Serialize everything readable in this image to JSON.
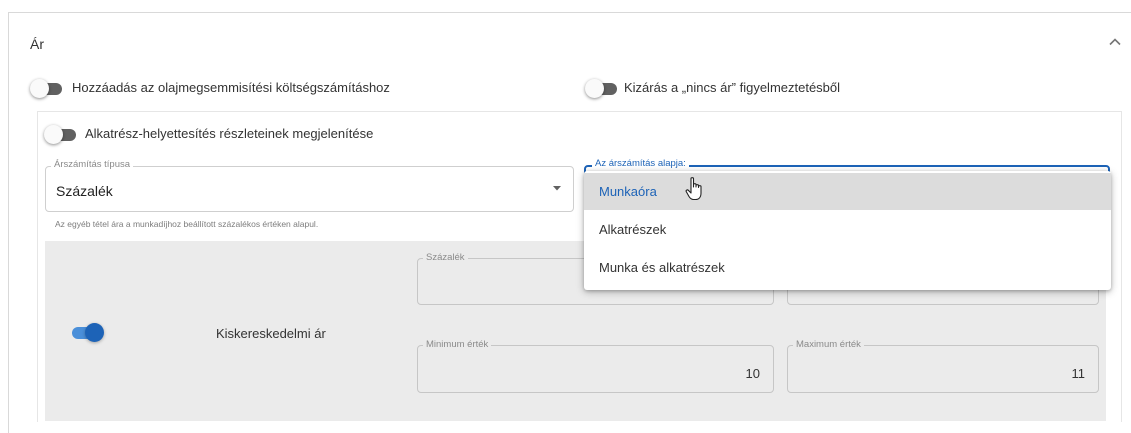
{
  "section": {
    "title": "Ár"
  },
  "toggles": {
    "oil_disposal": {
      "label": "Hozzáadás az olajmegsemmisítési költségszámításhoz",
      "on": false
    },
    "no_price_warning": {
      "label": "Kizárás a „nincs ár” figyelmeztetésből",
      "on": false
    },
    "part_substitution": {
      "label": "Alkatrész-helyettesítés részleteinek megjelenítése",
      "on": false
    },
    "retail_price": {
      "on": true
    }
  },
  "pricing_type": {
    "label": "Árszámítás típusa",
    "value": "Százalék",
    "helper": "Az egyéb tétel ára a munkadíjhoz beállított százalékos értéken alapul."
  },
  "pricing_basis": {
    "label": "Az árszámítás alapja:",
    "options": [
      "Munkaóra",
      "Alkatrészek",
      "Munka és alkatrészek"
    ],
    "highlighted": "Munkaóra"
  },
  "retail": {
    "label": "Kiskereskedelmi ár",
    "percent_label": "Százalék",
    "percent_value_partial": "0",
    "min_label": "Minimum érték",
    "min_value": "10",
    "max_label": "Maximum érték",
    "max_value": "11"
  },
  "icons": {
    "collapse": "chevron-up-icon",
    "dropdown": "triangle-down-icon",
    "cursor": "hand-pointer-icon"
  },
  "colors": {
    "accent": "#1d63b7",
    "toggle_off": "#616161",
    "panel_gray": "#ebebeb"
  }
}
